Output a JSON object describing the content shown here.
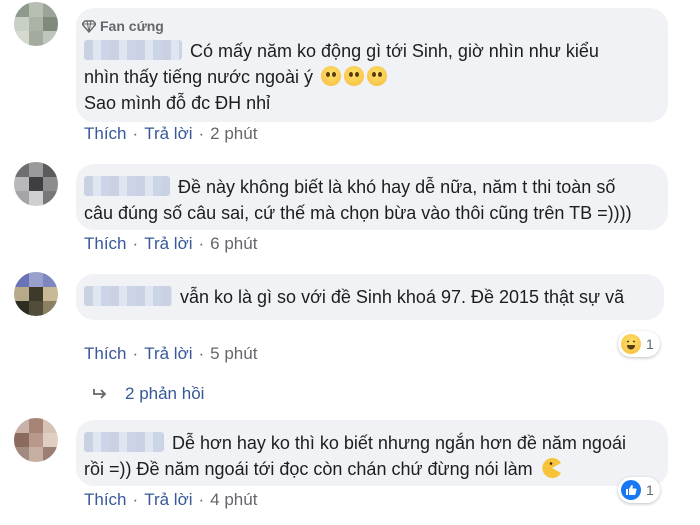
{
  "comments": [
    {
      "badge": "Fan cứng",
      "text_line1": "Có mấy năm ko động gì tới Sinh, giờ nhìn như kiểu",
      "text_line2": "nhìn thấy tiếng nước ngoài ý",
      "text_line3": "Sao mình đỗ đc ĐH nhỉ",
      "like": "Thích",
      "reply": "Trả lời",
      "time": "2 phút"
    },
    {
      "text_line1": "Đề này không biết là khó hay dễ nữa, năm t thi toàn số",
      "text_line2": "câu đúng số câu sai, cứ thế mà chọn bừa vào thôi cũng trên TB =))))",
      "like": "Thích",
      "reply": "Trả lời",
      "time": "6 phút"
    },
    {
      "text_line1": "vẫn ko là gì so với đề Sinh khoá 97. Đề 2015 thật sự vã",
      "like": "Thích",
      "reply": "Trả lời",
      "time": "5 phút",
      "reaction_count": "1"
    },
    {
      "text_line1": "Dễ hơn hay ko thì ko biết nhưng ngắn hơn đề năm ngoái",
      "text_line2": "rồi =)) Đề năm ngoái tới đọc còn chán chứ đừng nói làm",
      "like": "Thích",
      "reply": "Trả lời",
      "time": "4 phút",
      "reaction_count": "1"
    }
  ],
  "replies_toggle": "2 phản hồi",
  "icons": {
    "badge": "diamond-icon",
    "sad_emoji": "sad-emoji-icon",
    "laugh_reaction": "haha-reaction-icon",
    "like_reaction": "like-reaction-icon",
    "reply_arrow": "reply-arrow-icon",
    "pacman_emoji": "pacman-emoji-icon"
  },
  "colors": {
    "bubble": "#f0f2f5",
    "link": "#385898",
    "meta": "#65676b",
    "like_blue": "#1877f2"
  }
}
